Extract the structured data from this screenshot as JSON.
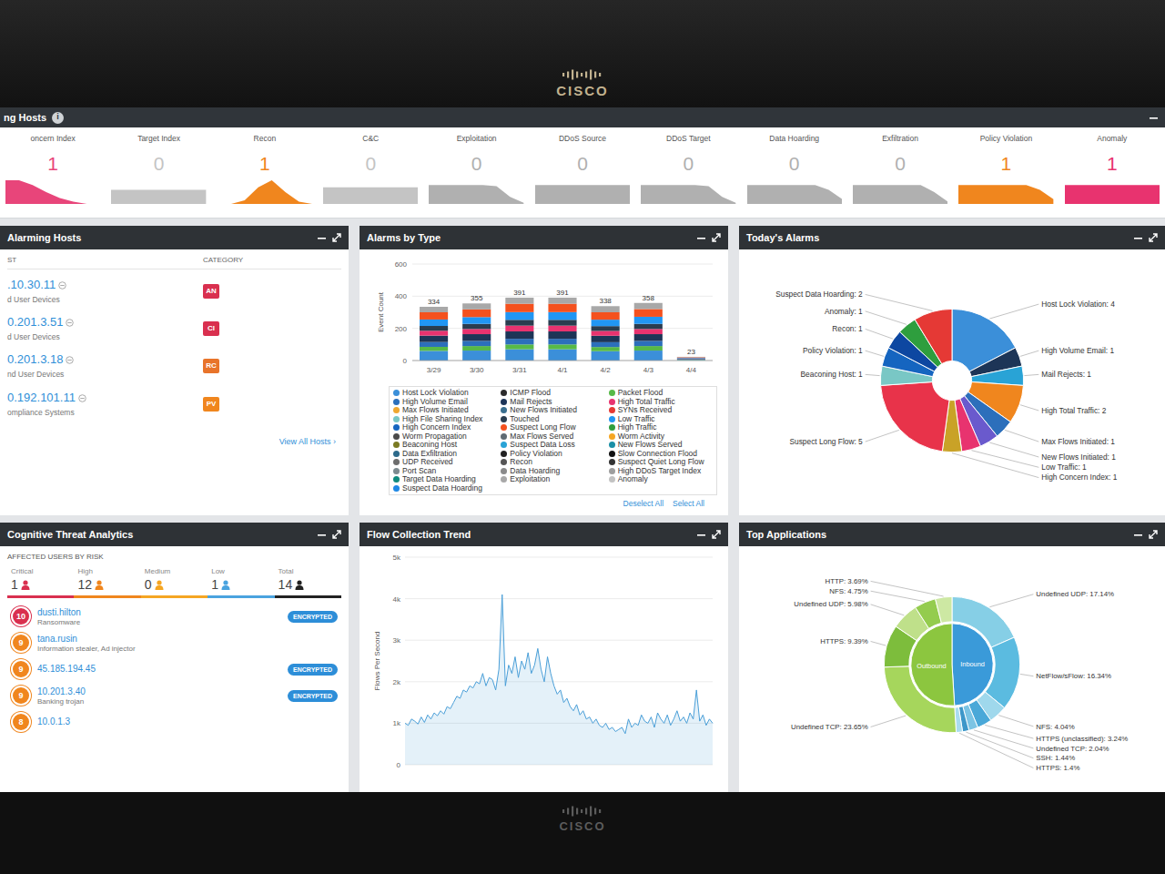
{
  "bezel": {
    "top_logo": "CISCO",
    "bottom_logo": "CISCO"
  },
  "strip": {
    "title": "ng Hosts",
    "info_icon": "i"
  },
  "metrics": [
    {
      "label": "oncern Index",
      "value": "1",
      "color": "#e8457a",
      "series": [
        1,
        1,
        0.8,
        0.5,
        0.25,
        0.1,
        0,
        0
      ]
    },
    {
      "label": "Target Index",
      "value": "0",
      "color": "#c4c4c4",
      "series": [
        0.6,
        0.6,
        0.6,
        0.6,
        0.6,
        0.6,
        0.6,
        0.6
      ]
    },
    {
      "label": "Recon",
      "value": "1",
      "color": "#f0861e",
      "series": [
        0,
        0,
        0.15,
        0.7,
        1,
        0.5,
        0.1,
        0
      ]
    },
    {
      "label": "C&C",
      "value": "0",
      "color": "#c4c4c4",
      "series": [
        0.7,
        0.7,
        0.7,
        0.7,
        0.7,
        0.7,
        0.7,
        0.7
      ]
    },
    {
      "label": "Exploitation",
      "value": "0",
      "color": "#b0b0b0",
      "series": [
        0.8,
        0.8,
        0.8,
        0.8,
        0.8,
        0.75,
        0.3,
        0.05
      ]
    },
    {
      "label": "DDoS Source",
      "value": "0",
      "color": "#b0b0b0",
      "series": [
        0.8,
        0.8,
        0.8,
        0.8,
        0.8,
        0.8,
        0.8,
        0.8
      ]
    },
    {
      "label": "DDoS Target",
      "value": "0",
      "color": "#b0b0b0",
      "series": [
        0.8,
        0.8,
        0.8,
        0.8,
        0.8,
        0.75,
        0.3,
        0.05
      ]
    },
    {
      "label": "Data Hoarding",
      "value": "0",
      "color": "#b0b0b0",
      "series": [
        0.8,
        0.8,
        0.8,
        0.8,
        0.8,
        0.8,
        0.6,
        0.2
      ]
    },
    {
      "label": "Exfiltration",
      "value": "0",
      "color": "#b0b0b0",
      "series": [
        0.8,
        0.8,
        0.8,
        0.8,
        0.8,
        0.8,
        0.5,
        0.1
      ]
    },
    {
      "label": "Policy Violation",
      "value": "1",
      "color": "#f0861e",
      "series": [
        0.8,
        0.8,
        0.8,
        0.8,
        0.8,
        0.8,
        0.6,
        0.2
      ]
    },
    {
      "label": "Anomaly",
      "value": "1",
      "color": "#e8336f",
      "series": [
        0.8,
        0.8,
        0.8,
        0.8,
        0.8,
        0.8,
        0.8,
        0.8
      ]
    }
  ],
  "alarming_hosts": {
    "title": "Alarming Hosts",
    "columns": [
      "ST",
      "CATEGORY"
    ],
    "rows": [
      {
        "host": ".10.30.11",
        "group": "d User Devices",
        "category": "AN",
        "color": "#d9304f"
      },
      {
        "host": "0.201.3.51",
        "group": "d User Devices",
        "category": "CI",
        "color": "#d9304f"
      },
      {
        "host": "0.201.3.18",
        "group": "nd User Devices",
        "category": "RC",
        "color": "#e8742a"
      },
      {
        "host": "0.192.101.11",
        "group": "ompliance Systems",
        "category": "PV",
        "color": "#f0861e"
      }
    ],
    "link": "View All Hosts ›"
  },
  "alarms_by_type": {
    "title": "Alarms by Type",
    "y_label": "Event Count",
    "y_ticks": [
      "600",
      "400",
      "200",
      "0"
    ],
    "dates": [
      "3/29",
      "3/30",
      "3/31",
      "4/1",
      "4/2",
      "4/3",
      "4/4"
    ],
    "totals": [
      "334",
      "355",
      "391",
      "391",
      "338",
      "358",
      "23"
    ],
    "series": [
      {
        "label": "Host Lock Violation",
        "color": "#3b8fd9",
        "values": [
          60,
          62,
          70,
          70,
          58,
          62,
          4
        ]
      },
      {
        "label": "ICMP Flood",
        "color": "#2b2b2b",
        "values": [
          0,
          0,
          0,
          0,
          0,
          0,
          0
        ]
      },
      {
        "label": "Packet Flood",
        "color": "#57b947",
        "values": [
          25,
          28,
          30,
          30,
          26,
          28,
          2
        ]
      },
      {
        "label": "High Volume Email",
        "color": "#2c6fbb",
        "values": [
          30,
          32,
          35,
          35,
          30,
          32,
          2
        ]
      },
      {
        "label": "Mail Rejects",
        "color": "#1d3557",
        "values": [
          40,
          42,
          46,
          46,
          40,
          42,
          3
        ]
      },
      {
        "label": "High Total Traffic",
        "color": "#e8336f",
        "values": [
          30,
          32,
          36,
          36,
          30,
          32,
          2
        ]
      },
      {
        "label": "Max Flows Initiated",
        "color": "#f0a830",
        "values": [
          0,
          0,
          0,
          0,
          0,
          0,
          0
        ]
      },
      {
        "label": "New Flows Initiated",
        "color": "#3a6f8f",
        "values": [
          0,
          0,
          0,
          0,
          0,
          0,
          0
        ]
      },
      {
        "label": "SYNs Received",
        "color": "#e53935",
        "values": [
          0,
          0,
          0,
          0,
          0,
          0,
          0
        ]
      },
      {
        "label": "High File Sharing Index",
        "color": "#79c7c5",
        "values": [
          0,
          0,
          0,
          0,
          0,
          0,
          0
        ]
      },
      {
        "label": "Touched",
        "color": "#2a3d4f",
        "values": [
          30,
          32,
          36,
          36,
          30,
          32,
          2
        ]
      },
      {
        "label": "Low Traffic",
        "color": "#2196f3",
        "values": [
          40,
          42,
          48,
          48,
          40,
          44,
          3
        ]
      },
      {
        "label": "High Concern Index",
        "color": "#1565c0",
        "values": [
          0,
          0,
          0,
          0,
          0,
          0,
          0
        ]
      },
      {
        "label": "Suspect Long Flow",
        "color": "#f4511e",
        "values": [
          45,
          48,
          52,
          52,
          46,
          48,
          3
        ]
      },
      {
        "label": "High Traffic",
        "color": "#2e9e3e",
        "values": [
          0,
          0,
          0,
          0,
          0,
          0,
          0
        ]
      },
      {
        "label": "Worm Propagation",
        "color": "#4a4a4a",
        "values": [
          0,
          0,
          0,
          0,
          0,
          0,
          0
        ]
      },
      {
        "label": "Max Flows Served",
        "color": "#5f6b73",
        "values": [
          0,
          0,
          0,
          0,
          0,
          0,
          0
        ]
      },
      {
        "label": "Worm Activity",
        "color": "#f5a623",
        "values": [
          0,
          0,
          0,
          0,
          0,
          0,
          0
        ]
      },
      {
        "label": "Beaconing Host",
        "color": "#7a7a22",
        "values": [
          0,
          0,
          0,
          0,
          0,
          0,
          0
        ]
      },
      {
        "label": "Suspect Data Loss",
        "color": "#29a3d6",
        "values": [
          0,
          0,
          0,
          0,
          0,
          0,
          0
        ]
      },
      {
        "label": "New Flows Served",
        "color": "#1b8fa6",
        "values": [
          0,
          0,
          0,
          0,
          0,
          0,
          0
        ]
      },
      {
        "label": "Data Exfiltration",
        "color": "#2d6a8a",
        "values": [
          0,
          0,
          0,
          0,
          0,
          0,
          0
        ]
      },
      {
        "label": "Policy Violation",
        "color": "#222222",
        "values": [
          0,
          0,
          0,
          0,
          0,
          0,
          0
        ]
      },
      {
        "label": "Slow Connection Flood",
        "color": "#111111",
        "values": [
          0,
          0,
          0,
          0,
          0,
          0,
          0
        ]
      },
      {
        "label": "UDP Received",
        "color": "#6d6d6d",
        "values": [
          0,
          0,
          0,
          0,
          0,
          0,
          0
        ]
      },
      {
        "label": "Recon",
        "color": "#555555",
        "values": [
          0,
          0,
          0,
          0,
          0,
          0,
          0
        ]
      },
      {
        "label": "Suspect Quiet Long Flow",
        "color": "#333333",
        "values": [
          0,
          0,
          0,
          0,
          0,
          0,
          0
        ]
      },
      {
        "label": "Port Scan",
        "color": "#7d8a8f",
        "values": [
          0,
          0,
          0,
          0,
          0,
          0,
          0
        ]
      },
      {
        "label": "Data Hoarding",
        "color": "#8a8a8a",
        "values": [
          0,
          0,
          0,
          0,
          0,
          0,
          0
        ]
      },
      {
        "label": "High DDoS Target Index",
        "color": "#9e9e9e",
        "values": [
          0,
          0,
          0,
          0,
          0,
          0,
          0
        ]
      },
      {
        "label": "Target Data Hoarding",
        "color": "#0f8a7e",
        "values": [
          0,
          0,
          0,
          0,
          0,
          0,
          0
        ]
      },
      {
        "label": "Exploitation",
        "color": "#a8a8a8",
        "values": [
          34,
          37,
          38,
          38,
          38,
          38,
          2
        ]
      },
      {
        "label": "Anomaly",
        "color": "#c2c2c2",
        "values": [
          0,
          0,
          0,
          0,
          0,
          0,
          0
        ]
      },
      {
        "label": "Suspect Data Hoarding",
        "color": "#1e88e5",
        "values": [
          0,
          0,
          0,
          0,
          0,
          0,
          0
        ]
      }
    ],
    "actions": [
      "Deselect All",
      "Select All"
    ]
  },
  "todays_alarms": {
    "title": "Today's Alarms",
    "slices": [
      {
        "text": "Host Lock Violation: 4",
        "value": 4,
        "color": "#3b8fd9"
      },
      {
        "text": "High Volume Email: 1",
        "value": 1,
        "color": "#1d3557"
      },
      {
        "text": "Mail Rejects: 1",
        "value": 1,
        "color": "#29a3d6"
      },
      {
        "text": "High Total Traffic: 2",
        "value": 2,
        "color": "#f0861e"
      },
      {
        "text": "Max Flows Initiated: 1",
        "value": 1,
        "color": "#2c6fbb"
      },
      {
        "text": "New Flows Initiated: 1",
        "value": 1,
        "color": "#6a5acd"
      },
      {
        "text": "Low Traffic: 1",
        "value": 1,
        "color": "#e8336f"
      },
      {
        "text": "High Concern Index: 1",
        "value": 1,
        "color": "#c9a227"
      },
      {
        "text": "Suspect Long Flow: 5",
        "value": 5,
        "color": "#e8334a"
      },
      {
        "text": "Beaconing Host: 1",
        "value": 1,
        "color": "#79c7c5"
      },
      {
        "text": "Policy Violation: 1",
        "value": 1,
        "color": "#1565c0"
      },
      {
        "text": "Recon: 1",
        "value": 1,
        "color": "#0d47a1"
      },
      {
        "text": "Anomaly: 1",
        "value": 1,
        "color": "#2e9e3e"
      },
      {
        "text": "Suspect Data Hoarding: 2",
        "value": 2,
        "color": "#e53935"
      }
    ]
  },
  "cognitive": {
    "title": "Cognitive Threat Analytics",
    "subtitle": "AFFECTED USERS BY RISK",
    "stats": [
      {
        "label": "Critical",
        "value": "1",
        "color": "#d9304f"
      },
      {
        "label": "High",
        "value": "12",
        "color": "#f0861e"
      },
      {
        "label": "Medium",
        "value": "0",
        "color": "#f5a623"
      },
      {
        "label": "Low",
        "value": "1",
        "color": "#4aa3df"
      },
      {
        "label": "Total",
        "value": "14",
        "color": "#222222"
      }
    ],
    "users": [
      {
        "score": "10",
        "name": "dusti.hilton",
        "detail": "Ransomware",
        "badge": "ENCRYPTED",
        "color": "#d9304f"
      },
      {
        "score": "9",
        "name": "tana.rusin",
        "detail": "Information stealer, Ad injector",
        "color": "#f0861e"
      },
      {
        "score": "9",
        "name": "45.185.194.45",
        "badge": "ENCRYPTED",
        "color": "#f0861e"
      },
      {
        "score": "9",
        "name": "10.201.3.40",
        "detail": "Banking trojan",
        "badge": "ENCRYPTED",
        "color": "#f0861e"
      },
      {
        "score": "8",
        "name": "10.0.1.3",
        "color": "#f0861e"
      }
    ]
  },
  "flow_trend": {
    "title": "Flow Collection Trend",
    "y_label": "Flows Per Second",
    "y_ticks": [
      "5k",
      "4k",
      "3k",
      "2k",
      "1k",
      "0"
    ],
    "values": [
      1000,
      950,
      1100,
      1050,
      980,
      1150,
      1020,
      1200,
      1100,
      1250,
      1180,
      1300,
      1220,
      1400,
      1350,
      1500,
      1650,
      1600,
      1800,
      1750,
      1900,
      1850,
      2000,
      1950,
      2200,
      1900,
      2100,
      2050,
      1800,
      2300,
      4100,
      1900,
      2400,
      2200,
      2600,
      2100,
      2500,
      2300,
      2700,
      2200,
      2400,
      2800,
      2300,
      2000,
      2600,
      2200,
      1900,
      1700,
      1800,
      1500,
      1600,
      1400,
      1300,
      1450,
      1200,
      1300,
      1100,
      1150,
      1000,
      1100,
      950,
      900,
      1000,
      850,
      900,
      800,
      850,
      900,
      750,
      1100,
      900,
      1000,
      950,
      1200,
      1050,
      1000,
      1150,
      900,
      1250,
      1100,
      1000,
      1200,
      950,
      1100,
      1300,
      1050,
      1150,
      1000,
      1250,
      1100,
      1800,
      1050,
      1200,
      950,
      1100,
      1000
    ]
  },
  "top_applications": {
    "title": "Top Applications",
    "groups": [
      {
        "label": "Inbound",
        "color": "#3a9ad9",
        "slices": [
          {
            "text": "Undefined UDP: 17.14%",
            "value": 17.14,
            "color": "#86cfe6"
          },
          {
            "text": "NetFlow/sFlow: 16.34%",
            "value": 16.34,
            "color": "#5bbbe0"
          },
          {
            "text": "NFS: 4.04%",
            "value": 4.04,
            "color": "#9fd8ec"
          },
          {
            "text": "HTTPS (unclassified): 3.24%",
            "value": 3.24,
            "color": "#4aa8d8"
          },
          {
            "text": "Undefined TCP: 2.04%",
            "value": 2.04,
            "color": "#7cc4e4"
          },
          {
            "text": "SSH: 1.44%",
            "value": 1.44,
            "color": "#3d97c9"
          },
          {
            "text": "HTTPS: 1.4%",
            "value": 1.4,
            "color": "#a9dcef"
          }
        ]
      },
      {
        "label": "Outbound",
        "color": "#8cc63f",
        "slices": [
          {
            "text": "Undefined TCP: 23.65%",
            "value": 23.65,
            "color": "#a6d65c"
          },
          {
            "text": "HTTPS: 9.39%",
            "value": 9.39,
            "color": "#7dbd3c"
          },
          {
            "text": "Undefined UDP: 5.98%",
            "value": 5.98,
            "color": "#bfe08a"
          },
          {
            "text": "NFS: 4.75%",
            "value": 4.75,
            "color": "#94cc4e"
          },
          {
            "text": "HTTP: 3.69%",
            "value": 3.69,
            "color": "#cde8a3"
          }
        ]
      }
    ]
  }
}
